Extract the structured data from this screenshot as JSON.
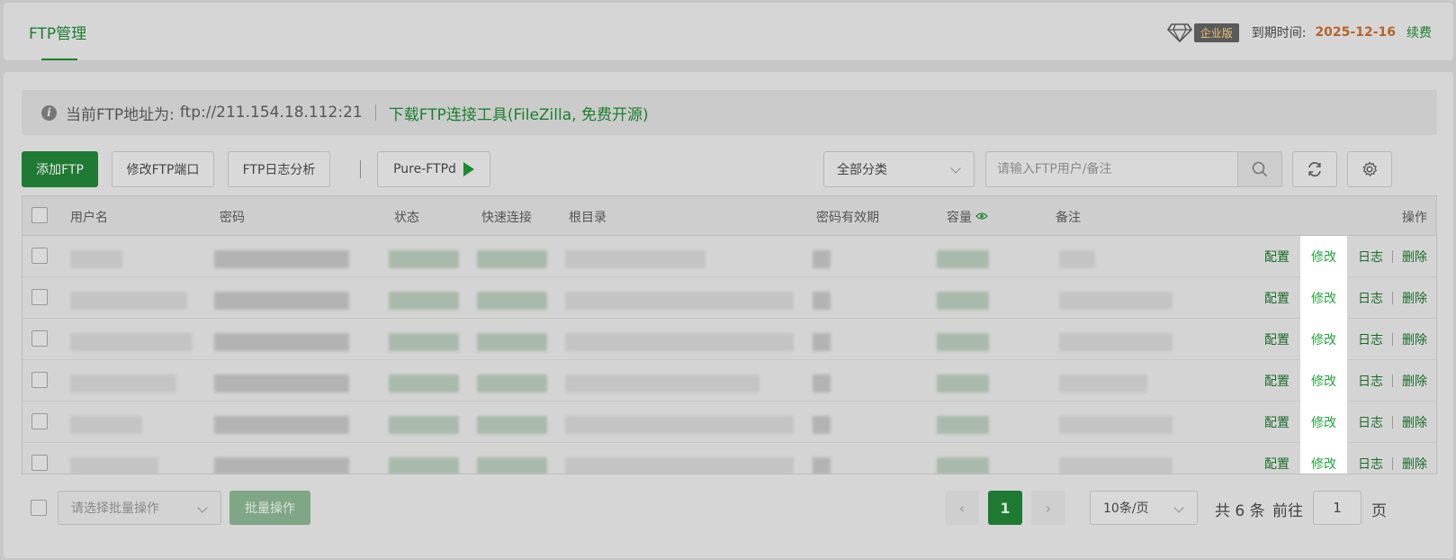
{
  "header": {
    "tab_label": "FTP管理",
    "vip_badge": "企业版",
    "expire_label": "到期时间:",
    "expire_date": "2025-12-16",
    "renew_label": "续费",
    "colors": {
      "brand": "#20a53a",
      "expire": "#b9622a"
    }
  },
  "notice": {
    "label": "当前FTP地址为:",
    "address": "ftp://211.154.18.112:21",
    "link": "下载FTP连接工具(FileZilla, 免费开源)"
  },
  "toolbar": {
    "add_ftp": "添加FTP",
    "modify_port": "修改FTP端口",
    "log_analysis": "FTP日志分析",
    "service": "Pure-FTPd",
    "category": "全部分类",
    "search_placeholder": "请输入FTP用户/备注"
  },
  "table": {
    "columns": {
      "username": "用户名",
      "password": "密码",
      "status": "状态",
      "quick_connect": "快速连接",
      "root_dir": "根目录",
      "pwd_expiry": "密码有效期",
      "capacity": "容量",
      "remark": "备注",
      "actions": "操作"
    },
    "ops": {
      "config": "配置",
      "modify": "修改",
      "log": "日志",
      "delete": "删除"
    },
    "rows": [
      {
        "id": 1
      },
      {
        "id": 2
      },
      {
        "id": 3
      },
      {
        "id": 4
      },
      {
        "id": 5
      },
      {
        "id": 6
      }
    ]
  },
  "footer": {
    "batch_placeholder": "请选择批量操作",
    "batch_button": "批量操作",
    "current_page": "1",
    "page_size": "10条/页",
    "total": "共 6 条",
    "goto_label": "前往",
    "goto_value": "1",
    "goto_suffix": "页"
  }
}
